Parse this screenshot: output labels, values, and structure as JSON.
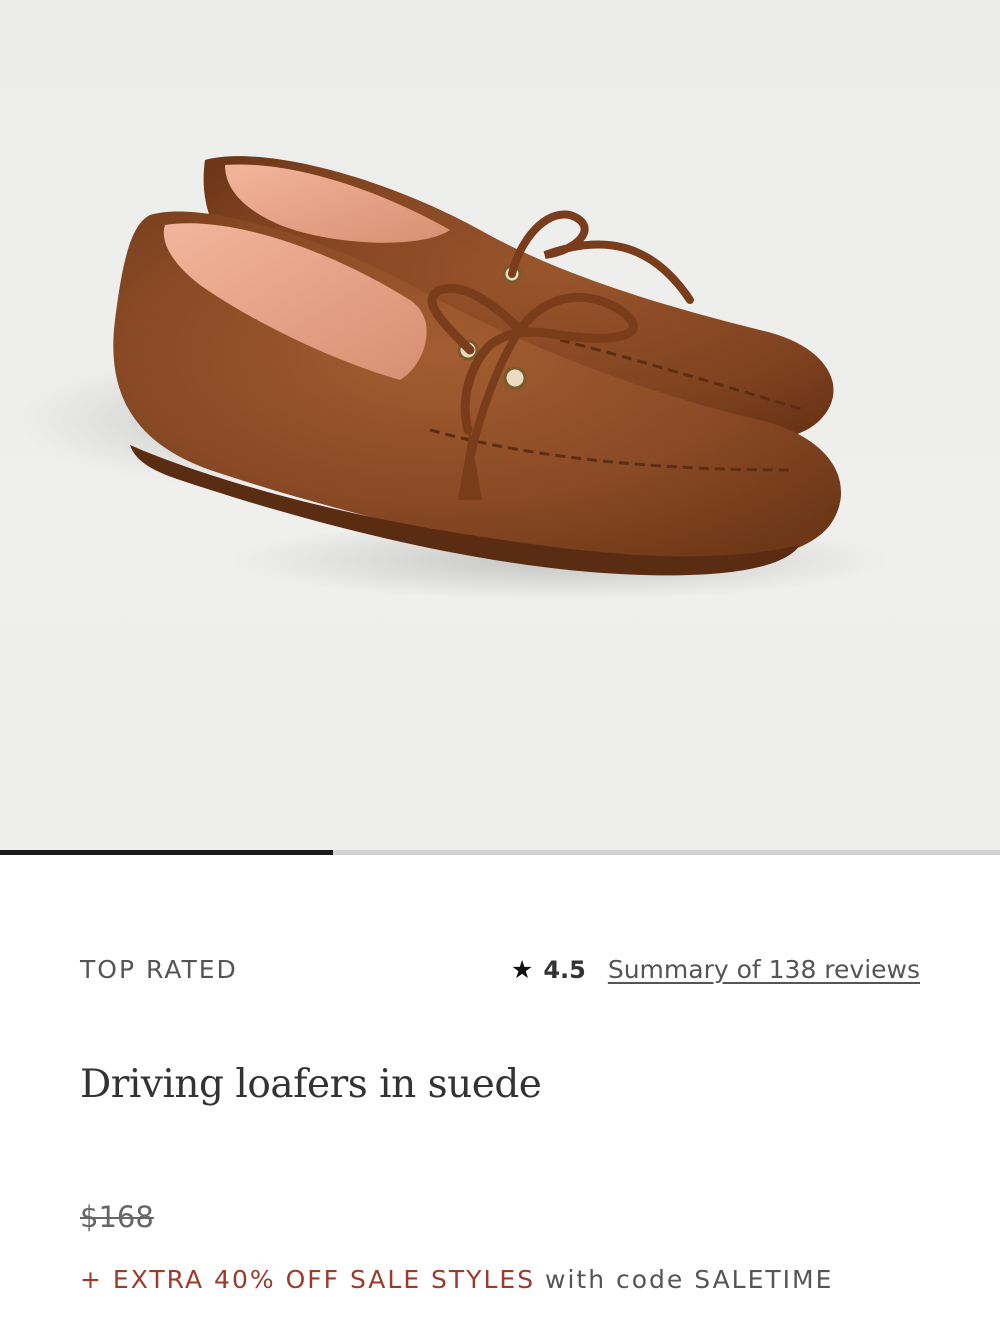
{
  "product": {
    "image_alt": "Brown suede driving loafers with leather laces and tassels",
    "colors": {
      "background": "#eeeeec",
      "suede": "#8a4a25",
      "lining": "#e8a890"
    }
  },
  "gallery": {
    "progress": 0.333,
    "colors": {
      "track": "#d2d2d2",
      "fill": "#1a1a1a"
    }
  },
  "badge": "TOP RATED",
  "rating": {
    "icon": "star-icon",
    "value": "4.5",
    "reviews_link": "Summary of 138 reviews"
  },
  "title": "Driving loafers in suede",
  "price": {
    "original": "$168"
  },
  "promo": {
    "highlight": "+ EXTRA 40% OFF SALE STYLES",
    "rest": "with code SALETIME",
    "accent_color": "#9a3b2b"
  }
}
